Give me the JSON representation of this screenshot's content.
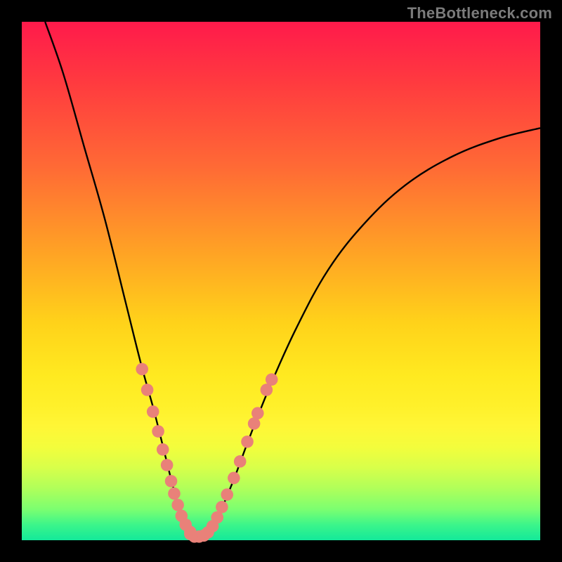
{
  "watermark": "TheBottleneck.com",
  "colors": {
    "frame": "#000000",
    "curve": "#000000",
    "dot": "#e98179"
  },
  "chart_data": {
    "type": "line",
    "title": "",
    "xlabel": "",
    "ylabel": "",
    "xlim": [
      0,
      100
    ],
    "ylim": [
      0,
      100
    ],
    "curve": [
      {
        "x": 4.5,
        "y": 100
      },
      {
        "x": 8,
        "y": 90
      },
      {
        "x": 12,
        "y": 76
      },
      {
        "x": 16,
        "y": 62
      },
      {
        "x": 20,
        "y": 46
      },
      {
        "x": 23,
        "y": 34
      },
      {
        "x": 25.5,
        "y": 25
      },
      {
        "x": 27.5,
        "y": 17
      },
      {
        "x": 29,
        "y": 11
      },
      {
        "x": 30.5,
        "y": 5.5
      },
      {
        "x": 32,
        "y": 2.2
      },
      {
        "x": 33.5,
        "y": 0.7
      },
      {
        "x": 35,
        "y": 0.7
      },
      {
        "x": 36.5,
        "y": 2.2
      },
      {
        "x": 38.5,
        "y": 6
      },
      {
        "x": 41,
        "y": 12
      },
      {
        "x": 44,
        "y": 20
      },
      {
        "x": 48,
        "y": 30
      },
      {
        "x": 53,
        "y": 41
      },
      {
        "x": 59,
        "y": 52
      },
      {
        "x": 66,
        "y": 61
      },
      {
        "x": 74,
        "y": 68.5
      },
      {
        "x": 83,
        "y": 74
      },
      {
        "x": 92,
        "y": 77.5
      },
      {
        "x": 100,
        "y": 79.5
      }
    ],
    "dots_left": [
      {
        "x": 23.2,
        "y": 33.0
      },
      {
        "x": 24.2,
        "y": 29.0
      },
      {
        "x": 25.3,
        "y": 24.8
      },
      {
        "x": 26.3,
        "y": 21.0
      },
      {
        "x": 27.2,
        "y": 17.5
      },
      {
        "x": 28.0,
        "y": 14.5
      },
      {
        "x": 28.8,
        "y": 11.4
      },
      {
        "x": 29.4,
        "y": 9.0
      },
      {
        "x": 30.1,
        "y": 6.8
      },
      {
        "x": 30.8,
        "y": 4.7
      },
      {
        "x": 31.6,
        "y": 3.0
      },
      {
        "x": 32.5,
        "y": 1.6
      }
    ],
    "dots_bottom": [
      {
        "x": 32.5,
        "y": 1.2
      },
      {
        "x": 33.3,
        "y": 0.7
      },
      {
        "x": 34.2,
        "y": 0.7
      },
      {
        "x": 35.1,
        "y": 0.9
      },
      {
        "x": 35.9,
        "y": 1.5
      }
    ],
    "dots_right": [
      {
        "x": 36.8,
        "y": 2.7
      },
      {
        "x": 37.7,
        "y": 4.4
      },
      {
        "x": 38.6,
        "y": 6.4
      },
      {
        "x": 39.6,
        "y": 8.8
      },
      {
        "x": 40.9,
        "y": 12.0
      },
      {
        "x": 42.1,
        "y": 15.2
      },
      {
        "x": 43.5,
        "y": 19.0
      },
      {
        "x": 44.8,
        "y": 22.5
      },
      {
        "x": 45.5,
        "y": 24.5
      },
      {
        "x": 47.2,
        "y": 29.0
      },
      {
        "x": 48.2,
        "y": 31.0
      }
    ]
  }
}
